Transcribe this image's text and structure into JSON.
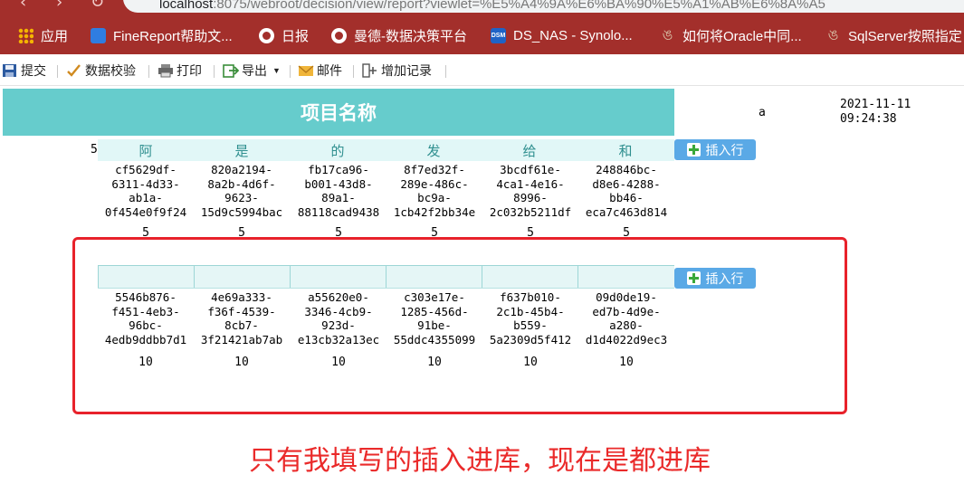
{
  "browser": {
    "url_host": "localhost",
    "url_rest": ":8075/webroot/decision/view/report?viewlet=%E5%A4%9A%E6%BA%90%E5%A1%AB%E6%8A%A5"
  },
  "bookmarks": [
    {
      "label": "应用",
      "icon": "apps-grid-icon"
    },
    {
      "label": "FineReport帮助文...",
      "icon": "finereport-icon"
    },
    {
      "label": "日报",
      "icon": "globe-icon"
    },
    {
      "label": "曼德-数据决策平台",
      "icon": "globe-icon"
    },
    {
      "label": "DS_NAS - Synolo...",
      "icon": "dsm-icon"
    },
    {
      "label": "如何将Oracle中同...",
      "icon": "oracle-icon"
    },
    {
      "label": "SqlServer按照指定",
      "icon": "oracle-icon"
    }
  ],
  "toolbar": {
    "submit": "提交",
    "validate": "数据校验",
    "print": "打印",
    "export": "导出",
    "mail": "邮件",
    "add_record": "增加记录"
  },
  "report": {
    "title": "项目名称",
    "cell_a": "a",
    "timestamp_date": "2021-11-11",
    "timestamp_time": "09:24:38",
    "left_number": "5",
    "headers": [
      "阿",
      "是",
      "的",
      "发",
      "给",
      "和"
    ],
    "insert_label": "插入行",
    "group1": {
      "ids": [
        [
          "cf5629df-",
          "6311-4d33-",
          "ab1a-",
          "0f454e0f9f24"
        ],
        [
          "820a2194-",
          "8a2b-4d6f-",
          "9623-",
          "15d9c5994bac"
        ],
        [
          "fb17ca96-",
          "b001-43d8-",
          "89a1-",
          "88118cad9438"
        ],
        [
          "8f7ed32f-",
          "289e-486c-",
          "bc9a-",
          "1cb42f2bb34e"
        ],
        [
          "3bcdf61e-",
          "4ca1-4e16-",
          "8996-",
          "2c032b5211df"
        ],
        [
          "248846bc-",
          "d8e6-4288-",
          "bb46-",
          "eca7c463d814"
        ]
      ],
      "counts": [
        "5",
        "5",
        "5",
        "5",
        "5",
        "5"
      ]
    },
    "group2": {
      "ids": [
        [
          "5546b876-",
          "f451-4eb3-",
          "96bc-",
          "4edb9ddbb7d1"
        ],
        [
          "4e69a333-",
          "f36f-4539-",
          "8cb7-",
          "3f21421ab7ab"
        ],
        [
          "a55620e0-",
          "3346-4cb9-",
          "923d-",
          "e13cb32a13ec"
        ],
        [
          "c303e17e-",
          "1285-456d-",
          "91be-",
          "55ddc4355099"
        ],
        [
          "f637b010-",
          "2c1b-45b4-",
          "b559-",
          "5a2309d5f412"
        ],
        [
          "09d0de19-",
          "ed7b-4d9e-",
          "a280-",
          "d1d4022d9ec3"
        ]
      ],
      "counts": [
        "10",
        "10",
        "10",
        "10",
        "10",
        "10"
      ]
    }
  },
  "annotation": "只有我填写的插入进库，现在是都进库",
  "colors": {
    "browser_bar": "#a32f2b",
    "title_bg": "#66cccc",
    "header_bg": "#e1f7f7",
    "insert_button": "#5aa9e6",
    "annotation_red": "#e8222b"
  }
}
